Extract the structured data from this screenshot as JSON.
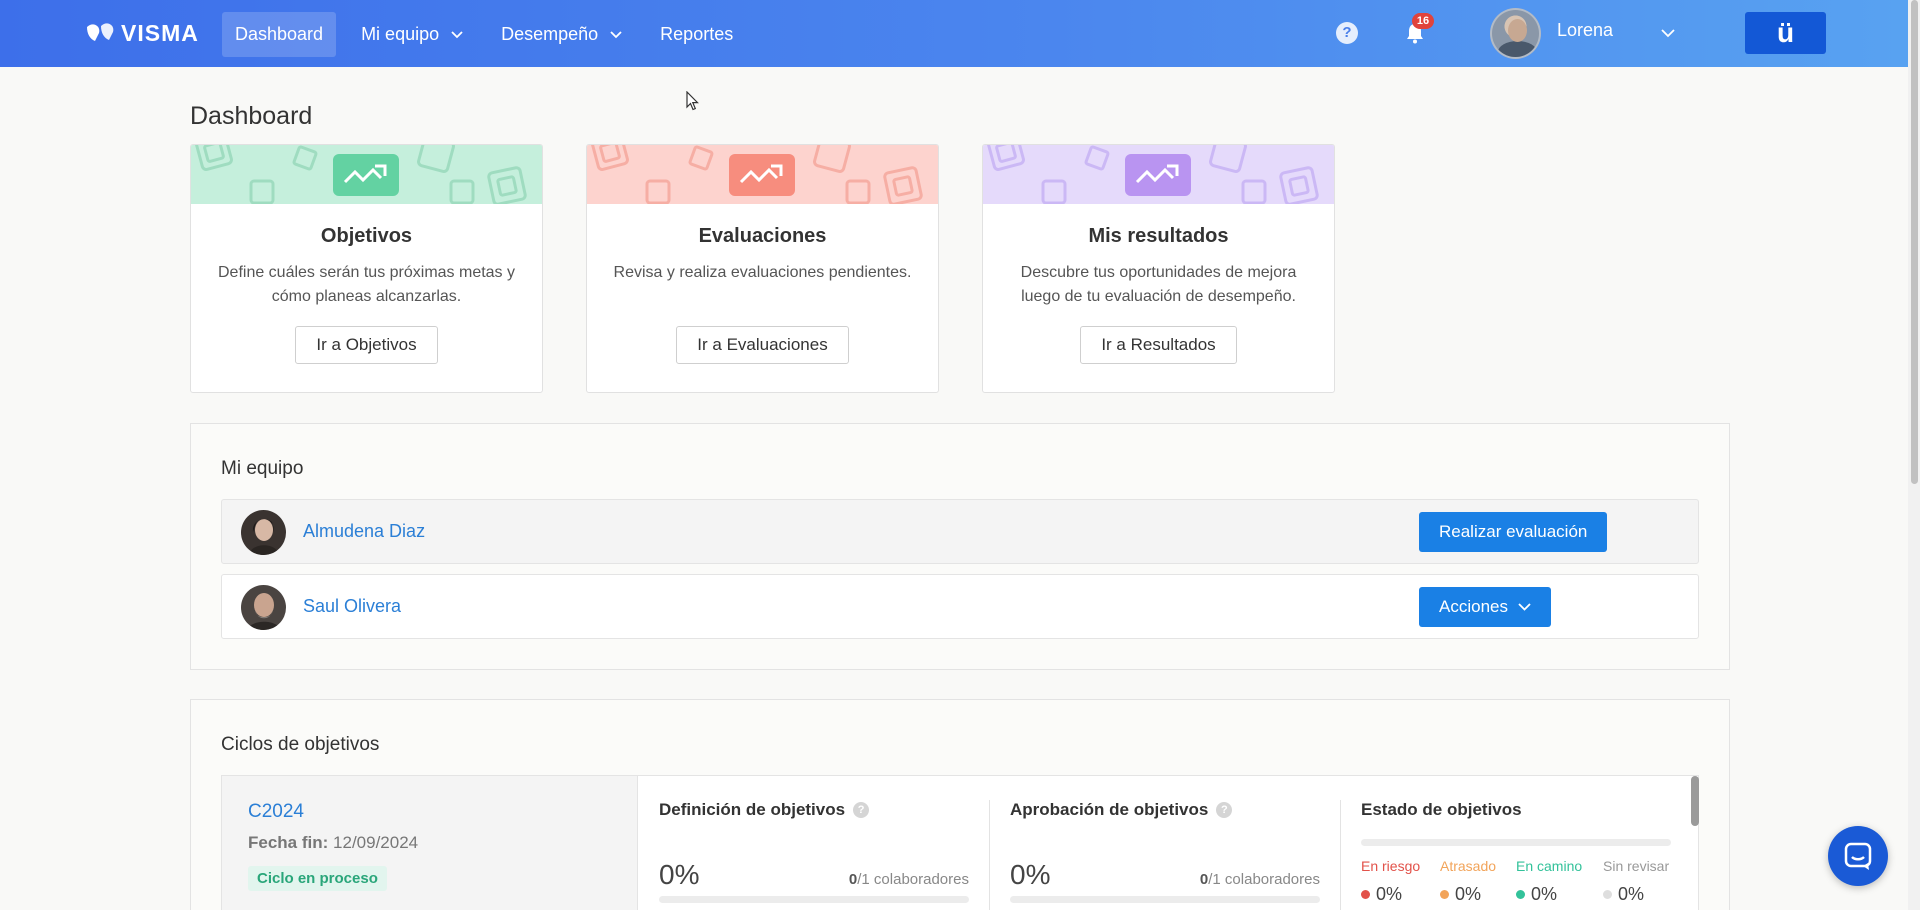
{
  "brand": {
    "name": "VISMA"
  },
  "nav": {
    "items": [
      {
        "label": "Dashboard",
        "active": true
      },
      {
        "label": "Mi equipo",
        "dropdown": true
      },
      {
        "label": "Desempeño",
        "dropdown": true
      },
      {
        "label": "Reportes"
      }
    ],
    "help_icon": "?",
    "notifications_count": "16",
    "user_name": "Lorena",
    "app_icon": "ü"
  },
  "page": {
    "title": "Dashboard"
  },
  "cards": [
    {
      "title": "Objetivos",
      "description": "Define cuáles serán tus próximas metas y cómo planeas alcanzarlas.",
      "button": "Ir a Objetivos",
      "color": "#b7ecd5",
      "accent": "#5fcf9f"
    },
    {
      "title": "Evaluaciones",
      "description": "Revisa y realiza evaluaciones pendientes.",
      "button": "Ir a Evaluaciones",
      "color": "#fdd1cc",
      "accent": "#f78b7c"
    },
    {
      "title": "Mis resultados",
      "description": "Descubre tus oportunidades de mejora luego de tu evaluación de desempeño.",
      "button": "Ir a Resultados",
      "color": "#e2d6fb",
      "accent": "#b592f2"
    }
  ],
  "team": {
    "title": "Mi equipo",
    "members": [
      {
        "name": "Almudena Diaz",
        "action": "Realizar evaluación"
      },
      {
        "name": "Saul Olivera",
        "action": "Acciones"
      }
    ]
  },
  "cycles": {
    "title": "Ciclos de objetivos",
    "items": [
      {
        "name": "C2024",
        "end_label": "Fecha fin:",
        "end_date": "12/09/2024",
        "status": "Ciclo en proceso",
        "definition": {
          "title": "Definición de objetivos",
          "percent": "0%",
          "done": "0",
          "total": "/1 colaboradores"
        },
        "approval": {
          "title": "Aprobación de objetivos",
          "percent": "0%",
          "done": "0",
          "total": "/1 colaboradores"
        },
        "estado": {
          "title": "Estado de objetivos",
          "legend": [
            {
              "label": "En riesgo",
              "value": "0%",
              "color": "#e2524a"
            },
            {
              "label": "Atrasado",
              "value": "0%",
              "color": "#f2a45a"
            },
            {
              "label": "En camino",
              "value": "0%",
              "color": "#33c29a"
            },
            {
              "label": "Sin revisar",
              "value": "0%",
              "color": "#dedede"
            }
          ]
        }
      }
    ]
  }
}
